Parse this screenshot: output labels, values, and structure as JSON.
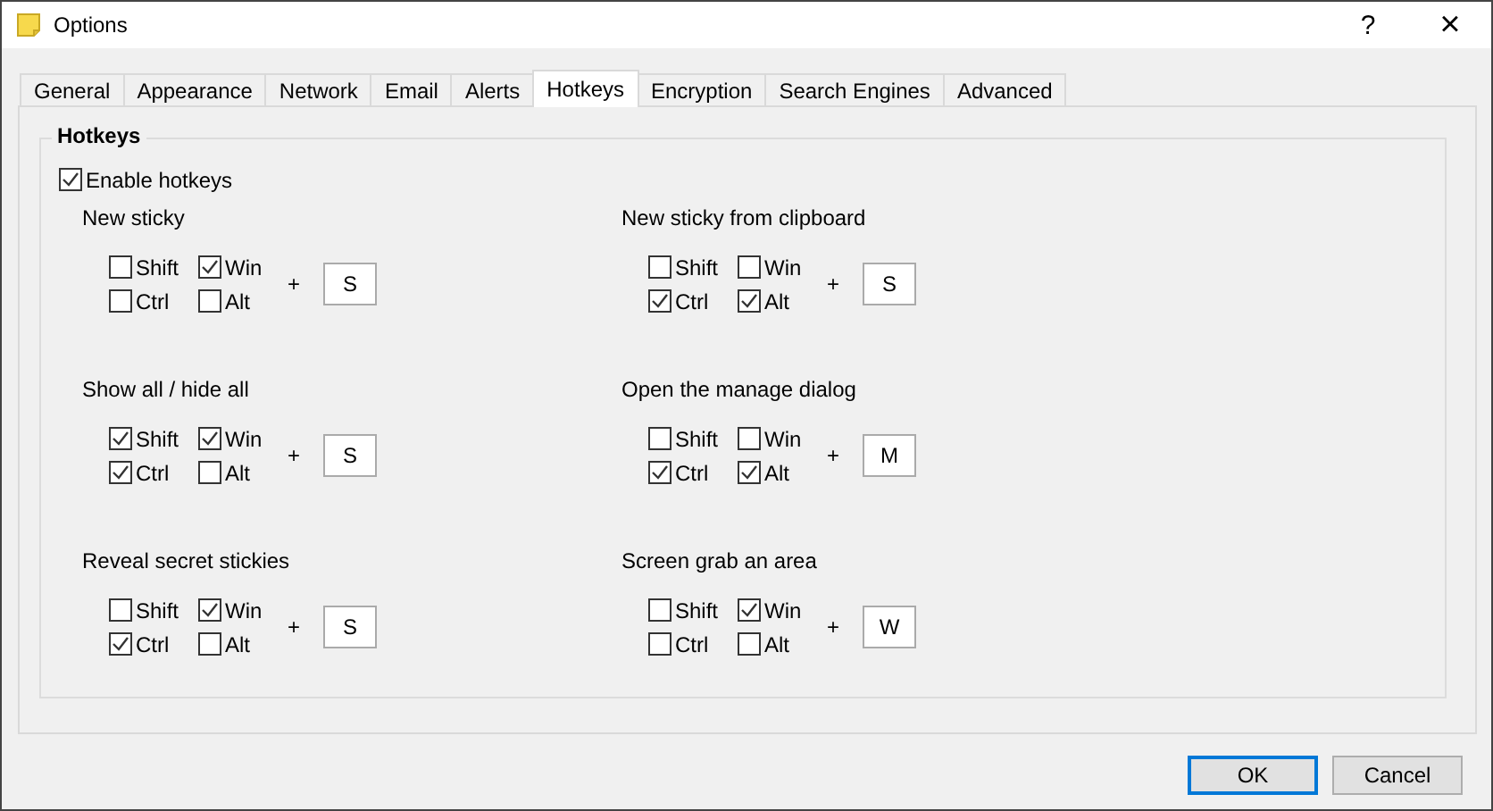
{
  "window": {
    "title": "Options",
    "help": "?",
    "close": "×"
  },
  "tabs": [
    {
      "label": "General",
      "selected": false
    },
    {
      "label": "Appearance",
      "selected": false
    },
    {
      "label": "Network",
      "selected": false
    },
    {
      "label": "Email",
      "selected": false
    },
    {
      "label": "Alerts",
      "selected": false
    },
    {
      "label": "Hotkeys",
      "selected": true
    },
    {
      "label": "Encryption",
      "selected": false
    },
    {
      "label": "Search Engines",
      "selected": false
    },
    {
      "label": "Advanced",
      "selected": false
    }
  ],
  "group": {
    "title": "Hotkeys",
    "enable": {
      "label": "Enable hotkeys",
      "checked": true
    },
    "hotkeys": [
      {
        "label": "New sticky",
        "modifiers": [
          {
            "label": "Shift",
            "checked": false
          },
          {
            "label": "Win",
            "checked": true
          },
          {
            "label": "Ctrl",
            "checked": false
          },
          {
            "label": "Alt",
            "checked": false
          }
        ],
        "plus": "+",
        "key": "S"
      },
      {
        "label": "New sticky from clipboard",
        "modifiers": [
          {
            "label": "Shift",
            "checked": false
          },
          {
            "label": "Win",
            "checked": false
          },
          {
            "label": "Ctrl",
            "checked": true
          },
          {
            "label": "Alt",
            "checked": true
          }
        ],
        "plus": "+",
        "key": "S"
      },
      {
        "label": "Show all / hide all",
        "modifiers": [
          {
            "label": "Shift",
            "checked": true
          },
          {
            "label": "Win",
            "checked": true
          },
          {
            "label": "Ctrl",
            "checked": true
          },
          {
            "label": "Alt",
            "checked": false
          }
        ],
        "plus": "+",
        "key": "S"
      },
      {
        "label": "Open the manage dialog",
        "modifiers": [
          {
            "label": "Shift",
            "checked": false
          },
          {
            "label": "Win",
            "checked": false
          },
          {
            "label": "Ctrl",
            "checked": true
          },
          {
            "label": "Alt",
            "checked": true
          }
        ],
        "plus": "+",
        "key": "M"
      },
      {
        "label": "Reveal secret stickies",
        "modifiers": [
          {
            "label": "Shift",
            "checked": false
          },
          {
            "label": "Win",
            "checked": true
          },
          {
            "label": "Ctrl",
            "checked": true
          },
          {
            "label": "Alt",
            "checked": false
          }
        ],
        "plus": "+",
        "key": "S"
      },
      {
        "label": "Screen grab an area",
        "modifiers": [
          {
            "label": "Shift",
            "checked": false
          },
          {
            "label": "Win",
            "checked": true
          },
          {
            "label": "Ctrl",
            "checked": false
          },
          {
            "label": "Alt",
            "checked": false
          }
        ],
        "plus": "+",
        "key": "W"
      }
    ]
  },
  "buttons": [
    {
      "label": "OK",
      "default": true
    },
    {
      "label": "Cancel",
      "default": false
    }
  ]
}
